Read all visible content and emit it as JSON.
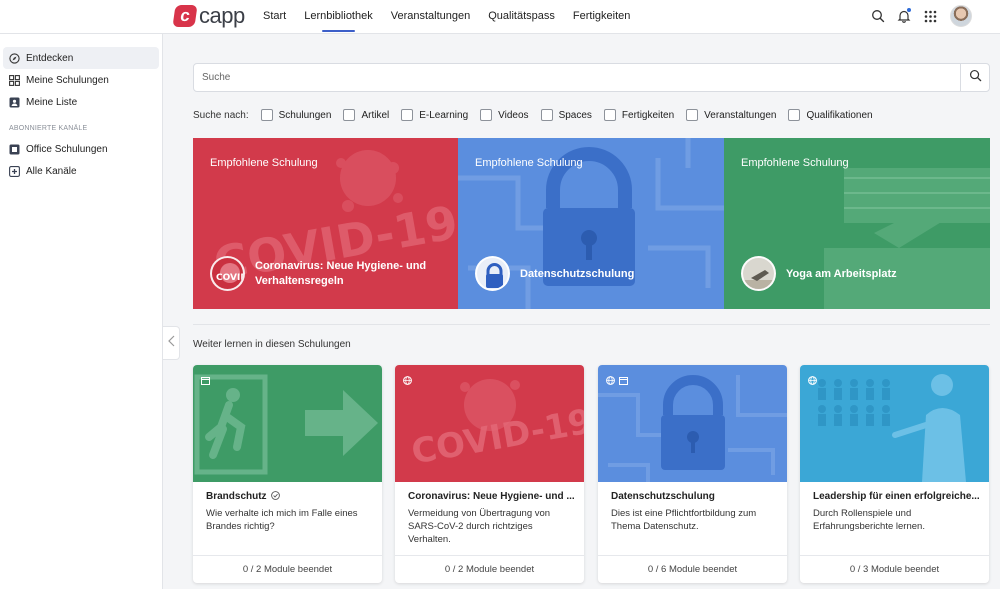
{
  "header": {
    "logo_mark": "c",
    "logo_text": "capp",
    "nav": [
      "Start",
      "Lernbibliothek",
      "Veranstaltungen",
      "Qualitätspass",
      "Fertigkeiten"
    ],
    "active_nav": "Lernbibliothek",
    "icons": [
      "search-icon",
      "bell-icon",
      "apps-grid-icon",
      "avatar"
    ]
  },
  "sidebar": {
    "items": [
      {
        "label": "Entdecken",
        "icon": "compass-icon",
        "active": true
      },
      {
        "label": "Meine Schulungen",
        "icon": "grid-icon",
        "active": false
      },
      {
        "label": "Meine Liste",
        "icon": "bookmark-icon",
        "active": false
      }
    ],
    "channels_heading": "ABONNIERTE KANÄLE",
    "channels": [
      {
        "label": "Office Schulungen",
        "icon": "channel-icon"
      },
      {
        "label": "Alle Kanäle",
        "icon": "channel-plus-icon"
      }
    ]
  },
  "search": {
    "placeholder": "Suche",
    "value": ""
  },
  "filters": {
    "label": "Suche nach:",
    "options": [
      "Schulungen",
      "Artikel",
      "E-Learning",
      "Videos",
      "Spaces",
      "Fertigkeiten",
      "Veranstaltungen",
      "Qualifikationen"
    ]
  },
  "hero": [
    {
      "tag": "Empfohlene Schulung",
      "title": "Coronavirus: Neue Hygiene- und Verhaltensregeln",
      "color": "#d23a4b",
      "image": "covid-19",
      "image_text": "COVID-19"
    },
    {
      "tag": "Empfohlene Schulung",
      "title": "Datenschutzschulung",
      "color": "#5b8ede",
      "image": "padlock"
    },
    {
      "tag": "Empfohlene Schulung",
      "title": "Yoga am Arbeitsplatz",
      "color": "#3e9b66",
      "image": "yoga"
    }
  ],
  "section_title": "Weiter lernen in diesen Schulungen",
  "cards": [
    {
      "title": "Brandschutz",
      "verified": true,
      "desc": "Wie verhalte ich mich im Falle eines Brandes richtig?",
      "progress": "0 / 2 Module beendet",
      "color": "#3e9b66",
      "image": "emergency-exit",
      "badges": [
        "calendar-icon"
      ]
    },
    {
      "title": "Coronavirus: Neue Hygiene- und ...",
      "verified": false,
      "desc": "Vermeidung von Übertragung von SARS-CoV-2 durch richtziges Verhalten.",
      "progress": "0 / 2 Module beendet",
      "color": "#d23a4b",
      "image": "covid-19",
      "image_text": "COVID-19",
      "badges": [
        "globe-icon"
      ]
    },
    {
      "title": "Datenschutzschulung",
      "verified": false,
      "desc": "Dies ist eine Pflichtfortbildung zum Thema Datenschutz.",
      "progress": "0 / 6 Module beendet",
      "color": "#5b8ede",
      "image": "padlock",
      "badges": [
        "globe-icon",
        "calendar-icon"
      ]
    },
    {
      "title": "Leadership für einen erfolgreiche...",
      "verified": false,
      "desc": "Durch Rollenspiele und Erfahrungsberichte lernen.",
      "progress": "0 / 3 Module beendet",
      "color": "#3ba7d6",
      "image": "leadership",
      "badges": [
        "globe-icon"
      ]
    }
  ]
}
